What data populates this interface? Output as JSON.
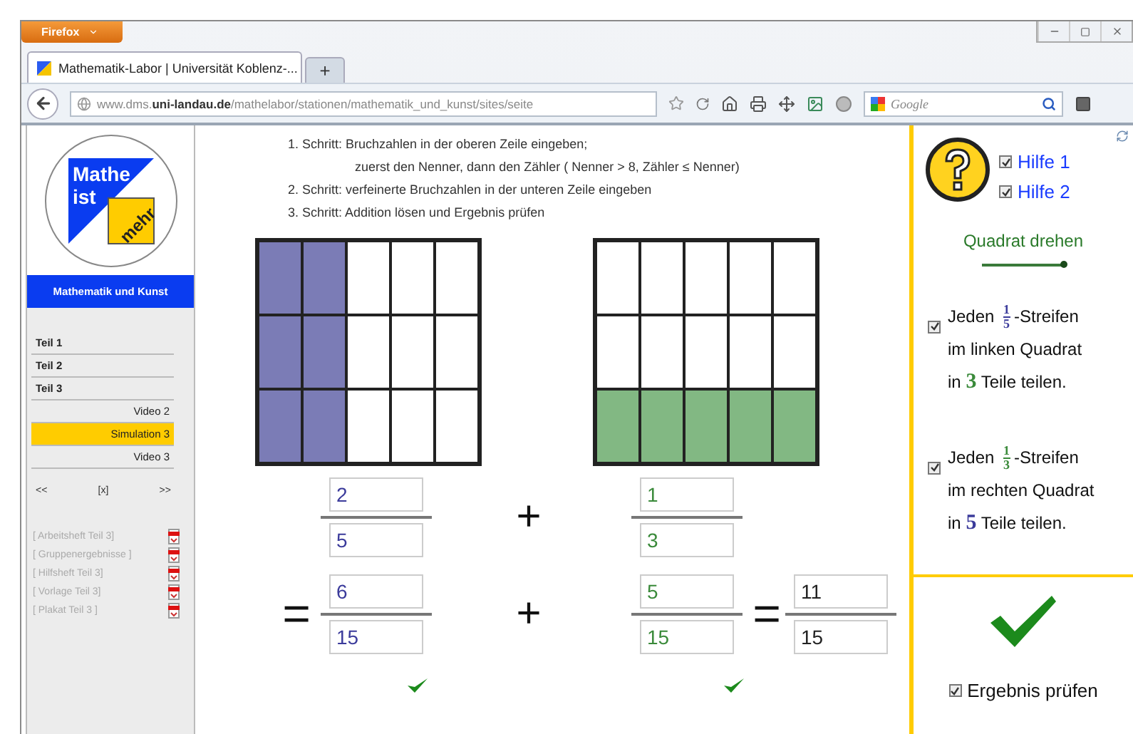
{
  "browser": {
    "app_button": "Firefox",
    "tabs": [
      {
        "title": "Mathematik-Labor | Universität Koblenz-...",
        "selected": true
      }
    ],
    "new_tab": "+",
    "url": "www.dms.**uni-landau.de**/mathelabor/stationen/mathematik_und_kunst/sites/seite",
    "search_placeholder": "Google"
  },
  "sidebar": {
    "logo": {
      "line1": "Mathe",
      "line2": "ist",
      "line3": "mehr"
    },
    "section_title": "Mathematik und Kunst",
    "nav": [
      {
        "label": "Teil 1",
        "kind": "part",
        "selected": false
      },
      {
        "label": "Teil 2",
        "kind": "part",
        "selected": false
      },
      {
        "label": "Teil 3",
        "kind": "part",
        "selected": false
      },
      {
        "label": "Video 2",
        "kind": "sub",
        "selected": false
      },
      {
        "label": "Simulation 3",
        "kind": "sub",
        "selected": true
      },
      {
        "label": "Video 3",
        "kind": "sub",
        "selected": false
      }
    ],
    "pager": [
      "<<",
      "[x]",
      ">>"
    ],
    "resources": [
      "[ Arbeitsheft Teil 3]",
      "[ Gruppenergebnisse ]",
      "[ Hilfsheft Teil 3]",
      "[ Vorlage Teil 3]",
      "[ Plakat Teil 3 ]"
    ]
  },
  "main": {
    "steps": [
      {
        "kind": "step",
        "text": "1. Schritt: Bruchzahlen in der oberen Zeile eingeben;"
      },
      {
        "kind": "continuation",
        "text": "zuerst den Nenner, dann den Zähler ( Nenner > 8, Zähler ≤ Nenner)"
      },
      {
        "kind": "step",
        "text": "2. Schritt: verfeinerte Bruchzahlen in der unteren Zeile eingeben"
      },
      {
        "kind": "step",
        "text": "3. Schritt: Addition lösen und Ergebnis prüfen"
      }
    ],
    "squares": [
      {
        "color": "#7b7cb6",
        "cells": [
          [
            true,
            true,
            false,
            false,
            false
          ],
          [
            true,
            true,
            false,
            false,
            false
          ],
          [
            true,
            true,
            false,
            false,
            false
          ]
        ]
      },
      {
        "color": "#82b883",
        "cells": [
          [
            false,
            false,
            false,
            false,
            false
          ],
          [
            false,
            false,
            false,
            false,
            false
          ],
          [
            true,
            true,
            true,
            true,
            true
          ]
        ]
      }
    ],
    "equations": [
      {
        "items": [
          {
            "kind": "fraction",
            "numerator": "2",
            "denominator": "5",
            "color": "#3b3b9b",
            "correct": false
          },
          {
            "kind": "operator",
            "symbol": "+"
          },
          {
            "kind": "fraction",
            "numerator": "1",
            "denominator": "3",
            "color": "#3a8a3a",
            "correct": false
          }
        ]
      },
      {
        "items": [
          {
            "kind": "operator",
            "symbol": "="
          },
          {
            "kind": "fraction",
            "numerator": "6",
            "denominator": "15",
            "color": "#3b3b9b",
            "correct": true
          },
          {
            "kind": "operator",
            "symbol": "+"
          },
          {
            "kind": "fraction",
            "numerator": "5",
            "denominator": "15",
            "color": "#3a8a3a",
            "correct": true
          },
          {
            "kind": "operator",
            "symbol": "="
          },
          {
            "kind": "fraction",
            "numerator": "11",
            "denominator": "15",
            "color": "#222222",
            "correct": false
          }
        ]
      }
    ]
  },
  "panel": {
    "help": [
      {
        "label": "Hilfe 1",
        "checked": true
      },
      {
        "label": "Hilfe 2",
        "checked": true
      }
    ],
    "rotate": {
      "label": "Quadrat drehen",
      "level": 1
    },
    "splits": [
      {
        "checked": true,
        "prefix": "Jeden",
        "fraction": {
          "numerator": "1",
          "denominator": "5",
          "color": "#3b3b9b"
        },
        "suffix": "-Streifen",
        "line2": "im linken Quadrat",
        "line3_prefix": "in",
        "number": {
          "text": "3",
          "color": "#3a8a3a"
        },
        "line3_suffix": "Teile teilen."
      },
      {
        "checked": true,
        "prefix": "Jeden",
        "fraction": {
          "numerator": "1",
          "denominator": "3",
          "color": "#3a8a3a"
        },
        "suffix": "-Streifen",
        "line2": "im rechten Quadrat",
        "line3_prefix": "in",
        "number": {
          "text": "5",
          "color": "#3b3b9b"
        },
        "line3_suffix": "Teile teilen."
      }
    ],
    "result_check": {
      "label": "Ergebnis prüfen",
      "checked": true
    }
  }
}
